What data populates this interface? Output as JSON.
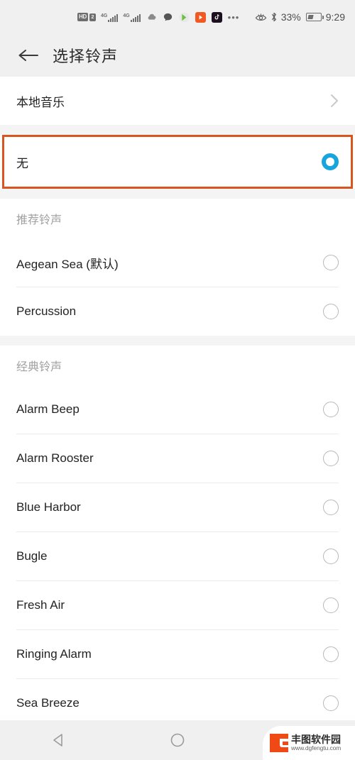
{
  "statusbar": {
    "hd_label": "HD",
    "sim_label": "2",
    "network_label_1": "4G",
    "network_label_2": "4G",
    "overflow_dots": "•••",
    "eye_comfort_icon": "eye-comfort-icon",
    "bluetooth_icon": "bluetooth-icon",
    "battery_percent": "33%",
    "time": "9:29",
    "app_icons": [
      {
        "name": "cloud-icon",
        "color": "#8a8a8a"
      },
      {
        "name": "message-icon",
        "color": "#555555"
      },
      {
        "name": "play-store-icon",
        "color": "#66bb44"
      },
      {
        "name": "video-app-icon",
        "color": "#f05a22"
      },
      {
        "name": "tiktok-icon",
        "color": "#1c1020"
      }
    ]
  },
  "header": {
    "back_icon": "back-arrow-icon",
    "title": "选择铃声"
  },
  "local_music": {
    "label": "本地音乐",
    "chevron_icon": "chevron-right-icon"
  },
  "selected_row": {
    "label": "无",
    "selected": true,
    "highlight_color": "#d9551f",
    "radio_color": "#18a4dc"
  },
  "sections": [
    {
      "title": "推荐铃声",
      "items": [
        {
          "label": "Aegean Sea (默认)",
          "selected": false
        },
        {
          "label": "Percussion",
          "selected": false
        }
      ]
    },
    {
      "title": "经典铃声",
      "items": [
        {
          "label": "Alarm Beep",
          "selected": false
        },
        {
          "label": "Alarm Rooster",
          "selected": false
        },
        {
          "label": "Blue Harbor",
          "selected": false
        },
        {
          "label": "Bugle",
          "selected": false
        },
        {
          "label": "Fresh Air",
          "selected": false
        },
        {
          "label": "Ringing Alarm",
          "selected": false
        },
        {
          "label": "Sea Breeze",
          "selected": false
        }
      ]
    }
  ],
  "navbar": {
    "back_icon": "nav-back-triangle-icon",
    "home_icon": "nav-home-circle-icon",
    "recents_icon": "nav-recents-square-icon"
  },
  "watermark": {
    "logo_icon": "fengtu-logo-icon",
    "name": "丰图软件园",
    "url": "www.dgfengtu.com"
  }
}
